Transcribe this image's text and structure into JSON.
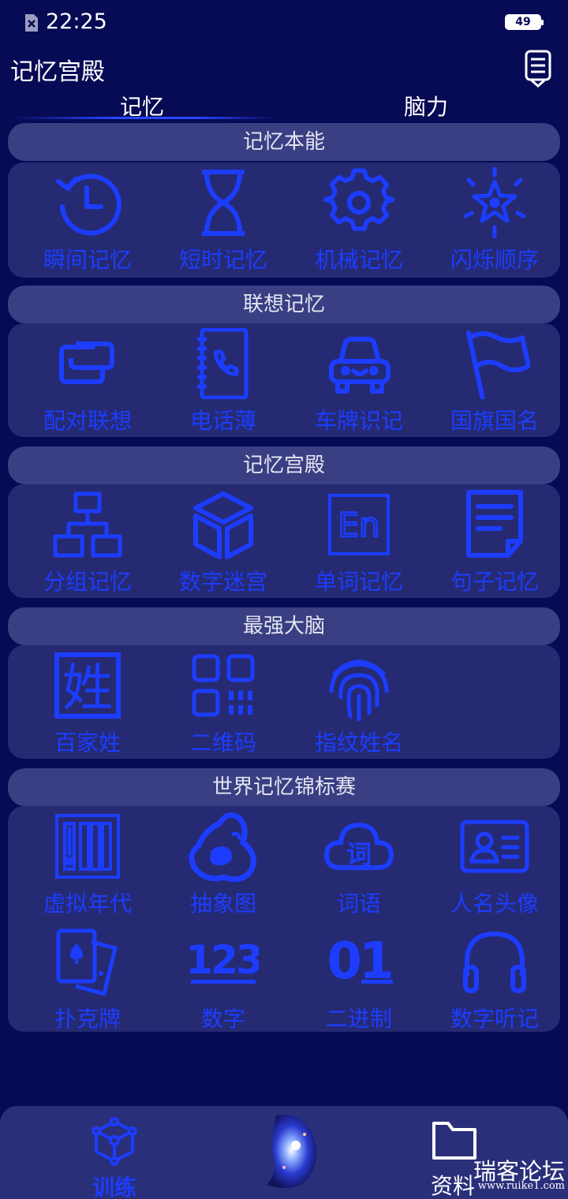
{
  "status_bar": {
    "time": "22:25",
    "battery": "49",
    "sim_icon": "no-sim-icon"
  },
  "header": {
    "title": "记忆宫殿",
    "menu_icon": "document-menu-icon"
  },
  "tabs": [
    {
      "label": "记忆",
      "active": true
    },
    {
      "label": "脑力",
      "active": false
    }
  ],
  "sections": [
    {
      "title": "记忆本能",
      "items": [
        {
          "label": "瞬间记忆",
          "icon": "clock-history-icon"
        },
        {
          "label": "短时记忆",
          "icon": "hourglass-icon"
        },
        {
          "label": "机械记忆",
          "icon": "gear-icon"
        },
        {
          "label": "闪烁顺序",
          "icon": "sparkle-star-icon"
        }
      ]
    },
    {
      "title": "联想记忆",
      "items": [
        {
          "label": "配对联想",
          "icon": "pair-link-icon"
        },
        {
          "label": "电话薄",
          "icon": "phonebook-icon"
        },
        {
          "label": "车牌识记",
          "icon": "car-icon"
        },
        {
          "label": "国旗国名",
          "icon": "flag-icon"
        }
      ]
    },
    {
      "title": "记忆宫殿",
      "items": [
        {
          "label": "分组记忆",
          "icon": "hierarchy-icon"
        },
        {
          "label": "数字迷宫",
          "icon": "cube-icon"
        },
        {
          "label": "单词记忆",
          "icon": "english-word-icon",
          "glyph": "En"
        },
        {
          "label": "句子记忆",
          "icon": "document-icon"
        }
      ]
    },
    {
      "title": "最强大脑",
      "items": [
        {
          "label": "百家姓",
          "icon": "surname-icon",
          "glyph": "姓"
        },
        {
          "label": "二维码",
          "icon": "qr-code-icon"
        },
        {
          "label": "指纹姓名",
          "icon": "fingerprint-icon"
        }
      ]
    },
    {
      "title": "世界记忆锦标赛",
      "items": [
        {
          "label": "虚拟年代",
          "icon": "timeline-icon"
        },
        {
          "label": "抽象图",
          "icon": "abstract-shape-icon"
        },
        {
          "label": "词语",
          "icon": "word-cloud-icon",
          "glyph": "词"
        },
        {
          "label": "人名头像",
          "icon": "id-card-icon"
        },
        {
          "label": "扑克牌",
          "icon": "poker-cards-icon"
        },
        {
          "label": "数字",
          "icon": "numbers-icon",
          "glyph": "123"
        },
        {
          "label": "二进制",
          "icon": "binary-icon",
          "glyph": "01"
        },
        {
          "label": "数字听记",
          "icon": "headphones-icon"
        }
      ]
    }
  ],
  "bottom_nav": {
    "train": {
      "label": "训练",
      "icon": "network-cube-icon"
    },
    "center": {
      "icon": "brain-galaxy-icon"
    },
    "files": {
      "label": "资料",
      "icon": "folder-icon"
    }
  },
  "watermark": {
    "title": "瑞客论坛",
    "url": "www.ruike1.com"
  },
  "colors": {
    "background": "#070a55",
    "card": "#262a73",
    "header": "#3a3e82",
    "accent": "#1c3dff"
  }
}
